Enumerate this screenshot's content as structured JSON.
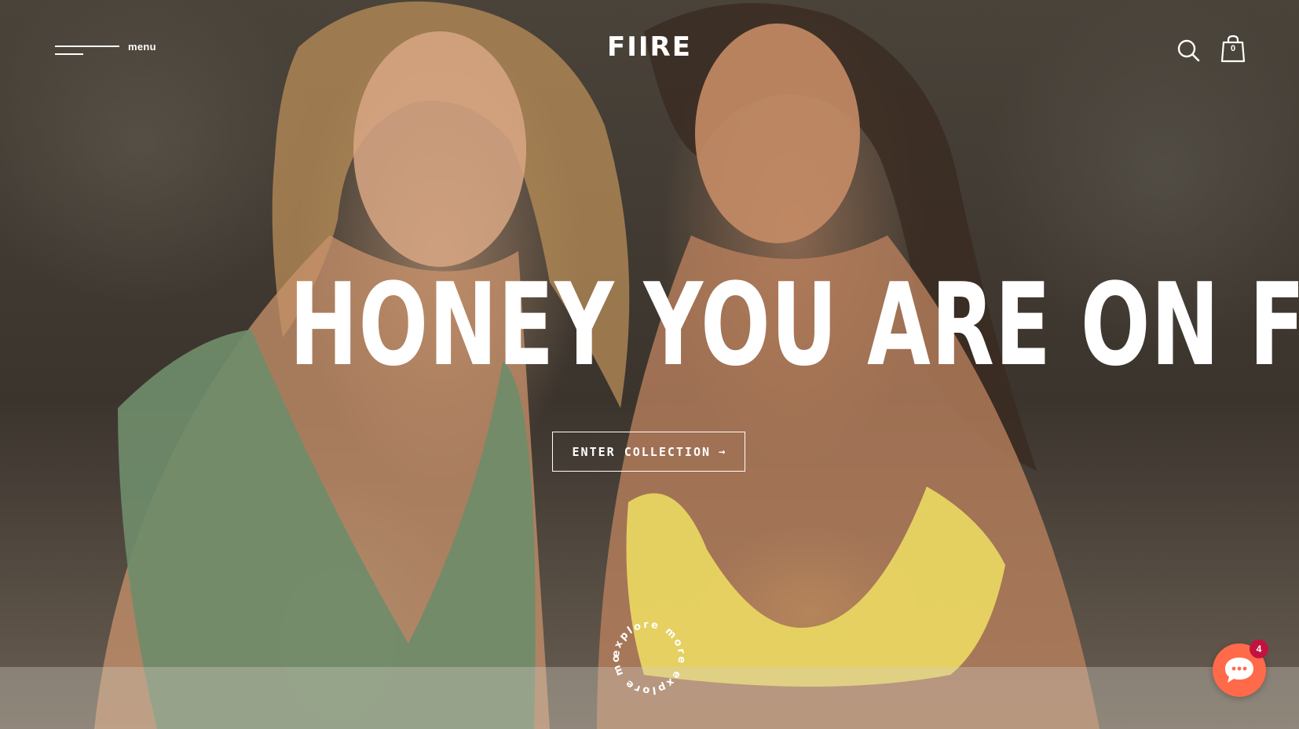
{
  "header": {
    "menu_label": "menu",
    "logo": "FIIRE",
    "cart_count": "0",
    "icons": {
      "menu": "hamburger-icon",
      "search": "search-icon",
      "cart": "shopping-bag-icon"
    }
  },
  "hero": {
    "headline": "HONEY YOU ARE ON FIIRE",
    "cta_label": "ENTER COLLECTION",
    "cta_arrow": "→",
    "explore_text": "explore more explore more"
  },
  "chat": {
    "badge": "4",
    "icon": "chat-bubble-icon",
    "color": "#ff6a4a",
    "badge_color": "#c4123f"
  }
}
